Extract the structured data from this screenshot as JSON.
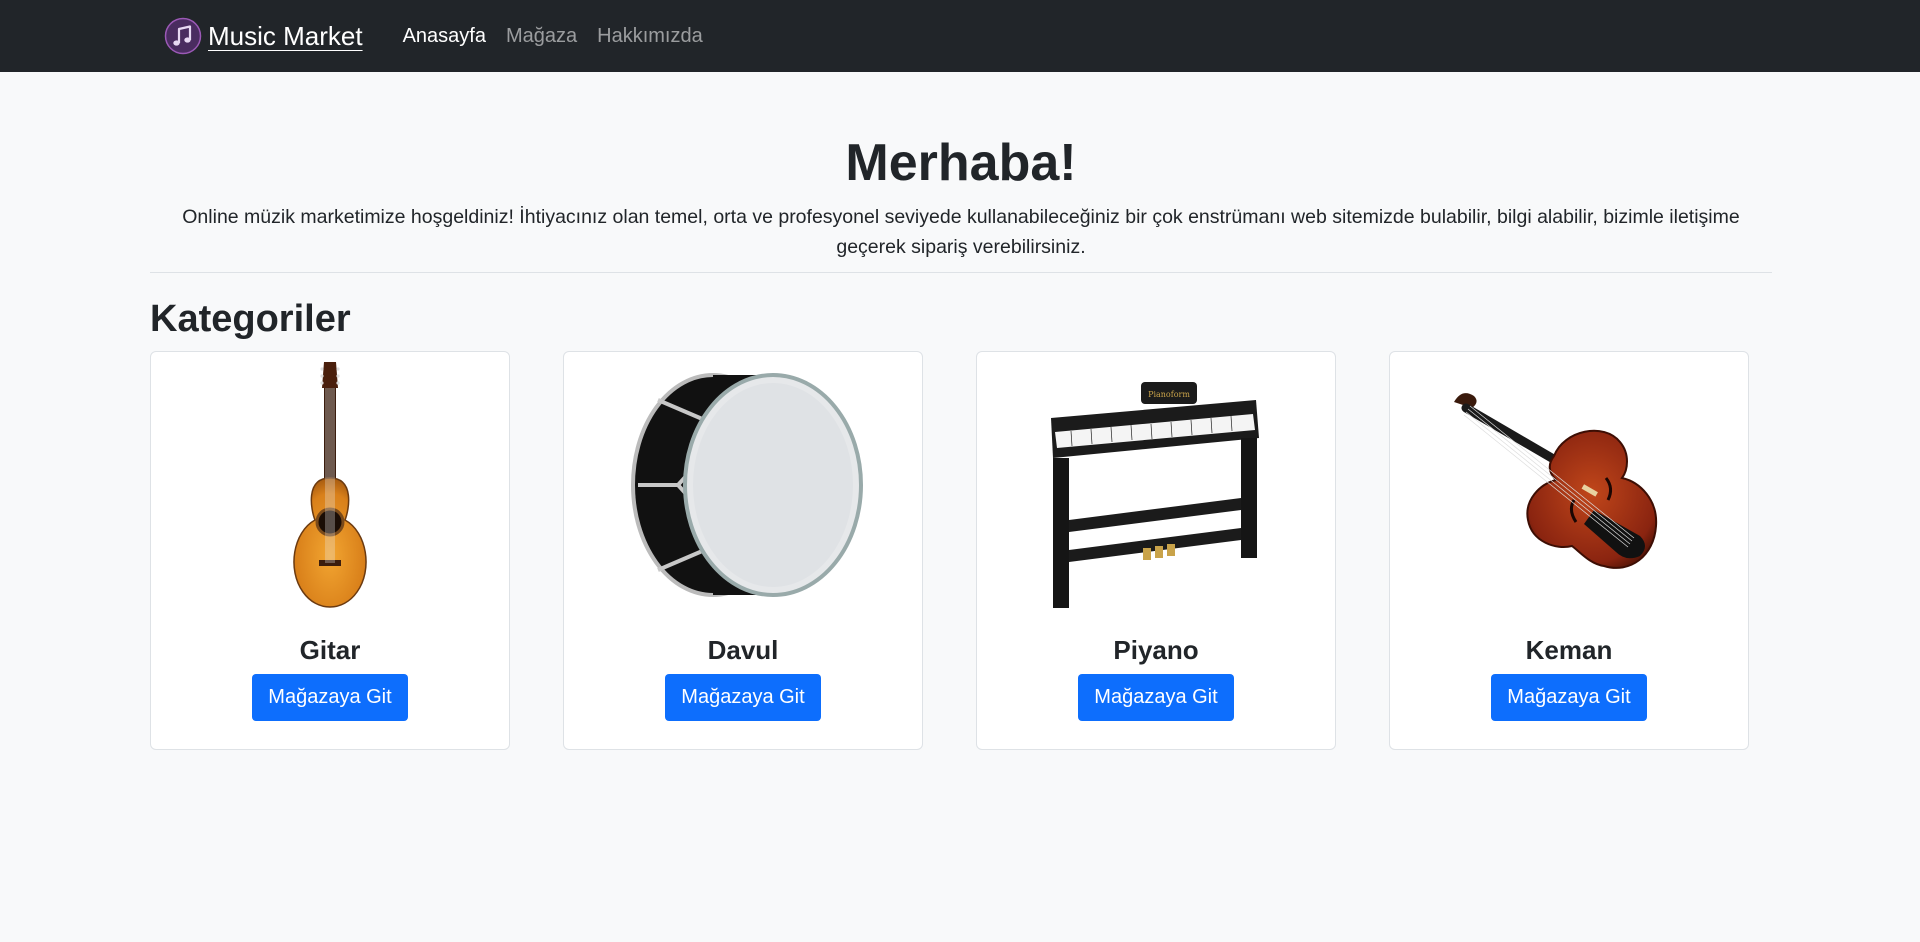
{
  "navbar": {
    "brand": "Music Market",
    "links": [
      {
        "label": "Anasayfa",
        "active": true
      },
      {
        "label": "Mağaza",
        "active": false
      },
      {
        "label": "Hakkımızda",
        "active": false
      }
    ]
  },
  "hero": {
    "title": "Merhaba!",
    "text": "Online müzik marketimize hoşgeldiniz! İhtiyacınız olan temel, orta ve profesyonel seviyede kullanabileceğiniz bir çok enstrümanı web sitemizde bulabilir, bilgi alabilir, bizimle iletişime geçerek sipariş verebilirsiniz."
  },
  "categories": {
    "title": "Kategoriler",
    "items": [
      {
        "name": "Gitar",
        "button": "Mağazaya Git",
        "image": "guitar"
      },
      {
        "name": "Davul",
        "button": "Mağazaya Git",
        "image": "drum"
      },
      {
        "name": "Piyano",
        "button": "Mağazaya Git",
        "image": "piano"
      },
      {
        "name": "Keman",
        "button": "Mağazaya Git",
        "image": "violin"
      }
    ]
  },
  "colors": {
    "navbar_bg": "#212529",
    "page_bg": "#f8f9fa",
    "primary": "#0d6efd",
    "logo_accent": "#8e44ad"
  }
}
